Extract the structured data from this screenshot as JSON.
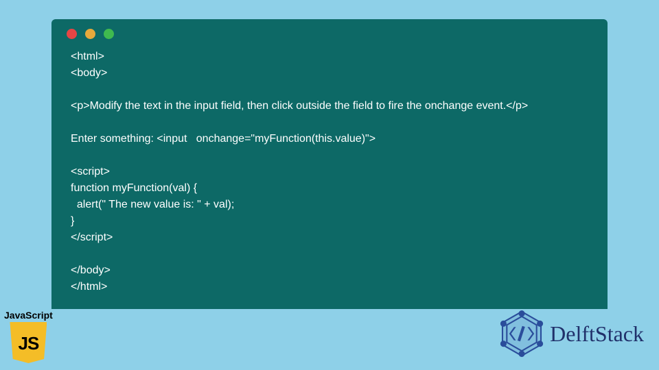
{
  "window": {
    "traffic_lights": [
      "red",
      "yellow",
      "green"
    ]
  },
  "code": {
    "lines": [
      "<html>",
      "<body>",
      "",
      "<p>Modify the text in the input field, then click outside the field to fire the onchange event.</p>",
      "",
      "Enter something: <input   onchange=\"myFunction(this.value)\">",
      "",
      "<script>",
      "function myFunction(val) {",
      "  alert(\" The new value is: \" + val);",
      "}",
      "</script>",
      "",
      "</body>",
      "</html>"
    ]
  },
  "js_badge": {
    "label": "JavaScript",
    "icon_text": "JS"
  },
  "brand": {
    "name": "DelftStack"
  }
}
